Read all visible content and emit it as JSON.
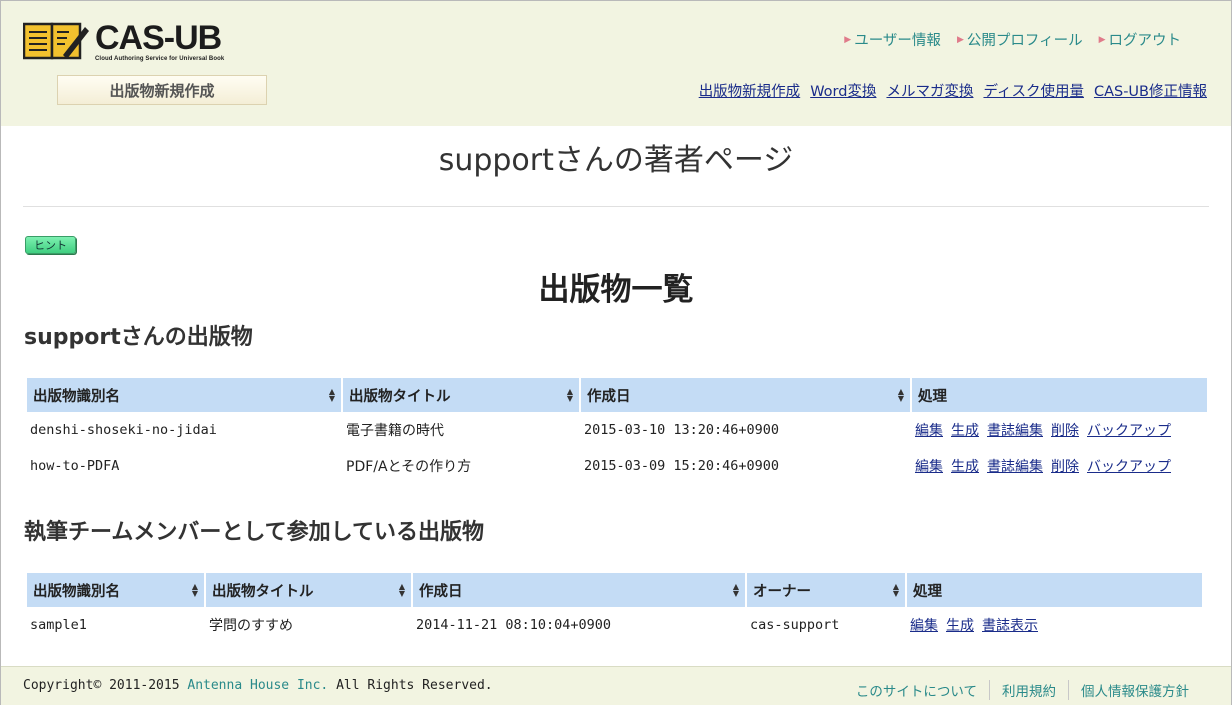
{
  "header": {
    "logo_title": "CAS-UB",
    "logo_subtitle": "Cloud Authoring Service for Universal Book",
    "new_pub_button": "出版物新規作成",
    "user_links": [
      "ユーザー情報",
      "公開プロフィール",
      "ログアウト"
    ],
    "nav_links": [
      "出版物新規作成",
      "Word変換",
      "メルマガ変換",
      "ディスク使用量",
      "CAS-UB修正情報"
    ]
  },
  "main": {
    "page_title": "supportさんの著者ページ",
    "hint_label": "ヒント",
    "list_title": "出版物一覧",
    "own_section_title": "supportさんの出版物",
    "team_section_title": "執筆チームメンバーとして参加している出版物"
  },
  "own_table": {
    "headers": [
      "出版物識別名",
      "出版物タイトル",
      "作成日",
      "処理"
    ],
    "rows": [
      {
        "id": "denshi-shoseki-no-jidai",
        "title": "電子書籍の時代",
        "date": "2015-03-10 13:20:46+0900",
        "actions": [
          "編集",
          "生成",
          "書誌編集",
          "削除",
          "バックアップ"
        ]
      },
      {
        "id": "how-to-PDFA",
        "title": "PDF/Aとその作り方",
        "date": "2015-03-09 15:20:46+0900",
        "actions": [
          "編集",
          "生成",
          "書誌編集",
          "削除",
          "バックアップ"
        ]
      }
    ]
  },
  "team_table": {
    "headers": [
      "出版物識別名",
      "出版物タイトル",
      "作成日",
      "オーナー",
      "処理"
    ],
    "rows": [
      {
        "id": "sample1",
        "title": "学問のすすめ",
        "date": "2014-11-21 08:10:04+0900",
        "owner": "cas-support",
        "actions": [
          "編集",
          "生成",
          "書誌表示"
        ]
      }
    ]
  },
  "footer": {
    "copyright_prefix": "Copyright© 2011-2015 ",
    "company": "Antenna House Inc.",
    "copyright_suffix": " All Rights Reserved.",
    "links": [
      "このサイトについて",
      "利用規約",
      "個人情報保護方針"
    ]
  },
  "colors": {
    "header_bg": "#f2f4e1",
    "table_header_bg": "#c4dcf5",
    "link": "#1a2c8a",
    "teal_link": "#2a8a8a",
    "hint_green": "#3fcf80"
  }
}
